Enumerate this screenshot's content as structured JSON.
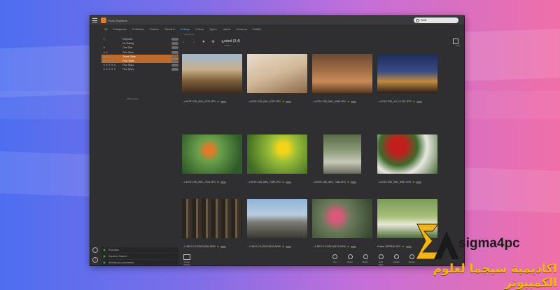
{
  "app": {
    "title": "Photo Supreme"
  },
  "search": {
    "value": "Stuff"
  },
  "tabs": [
    "All",
    "Categories",
    "Portfolios",
    "Folders",
    "Timeline",
    "Ratings",
    "Colors",
    "Types",
    "Labels",
    "Versions",
    "Details"
  ],
  "tabs_active_index": 5,
  "subtitle": "rated (3,4)",
  "sidebar": {
    "rows": [
      {
        "label": "Rejected",
        "stars": "✕"
      },
      {
        "label": "No Rating",
        "stars": ""
      },
      {
        "label": "One Star",
        "stars": "★"
      },
      {
        "label": "Two Stars",
        "stars": "★★"
      },
      {
        "label": "Three Stars",
        "stars": "★★★",
        "selected": true
      },
      {
        "label": "Four Stars",
        "stars": "★★★★",
        "selected": true
      },
      {
        "label": "Five Stars",
        "stars": "★★★★★"
      },
      {
        "label": "Five Stars",
        "stars": "★★★★★"
      }
    ],
    "hint": "2853 images"
  },
  "toolbar": {
    "back_icon": "arrow-left-icon",
    "forward_icon": "arrow-right-icon",
    "filter_icon": "filter-icon",
    "settings_icon": "gear-icon",
    "sort_icon": "sort-icon",
    "title": "rated (3,4)",
    "subtitle": "2 filters",
    "right_label": "Grid"
  },
  "images": [
    {
      "caption": "...n EOS 10D_IMG_4778.JPG"
    },
    {
      "caption": "...n EOS 10D_IMG_4787.JPG"
    },
    {
      "caption": "...n EOS 10D_IMG_4966.JPG"
    },
    {
      "caption": "...n EOS 20D_XIL-19 021.JPG"
    },
    {
      "caption": "...n EOS 10D_IMG_7214.JPG"
    },
    {
      "caption": "...n EOS 10D_IMG_7289.JPG"
    },
    {
      "caption": "...n EOS 10D_IMG_7383.JPG"
    },
    {
      "caption": "...n EOS 30D_IMG_8987.CR2"
    },
    {
      "caption": "...X-NEX-C3-DSC01335.ARW"
    },
    {
      "caption": "...X-NEX-C3-DSC01492.ARW"
    },
    {
      "caption": "...X-NEX-C3-DSC06473.ARW"
    },
    {
      "caption": "Pooler-SPRING.JPG"
    }
  ],
  "panels": [
    {
      "label": "Favorites"
    },
    {
      "label": "Dynamic Search"
    },
    {
      "label": "Activity (no processes)"
    }
  ],
  "bottom": {
    "group": "Group Toolbar",
    "icons": [
      "Info",
      "Share",
      "Batch",
      "Light Table",
      "Details",
      "Export"
    ]
  },
  "branding": {
    "name": "sigma4pc",
    "arabic": "اكاديمية سيجما لعلوم الكمبيوتر"
  }
}
